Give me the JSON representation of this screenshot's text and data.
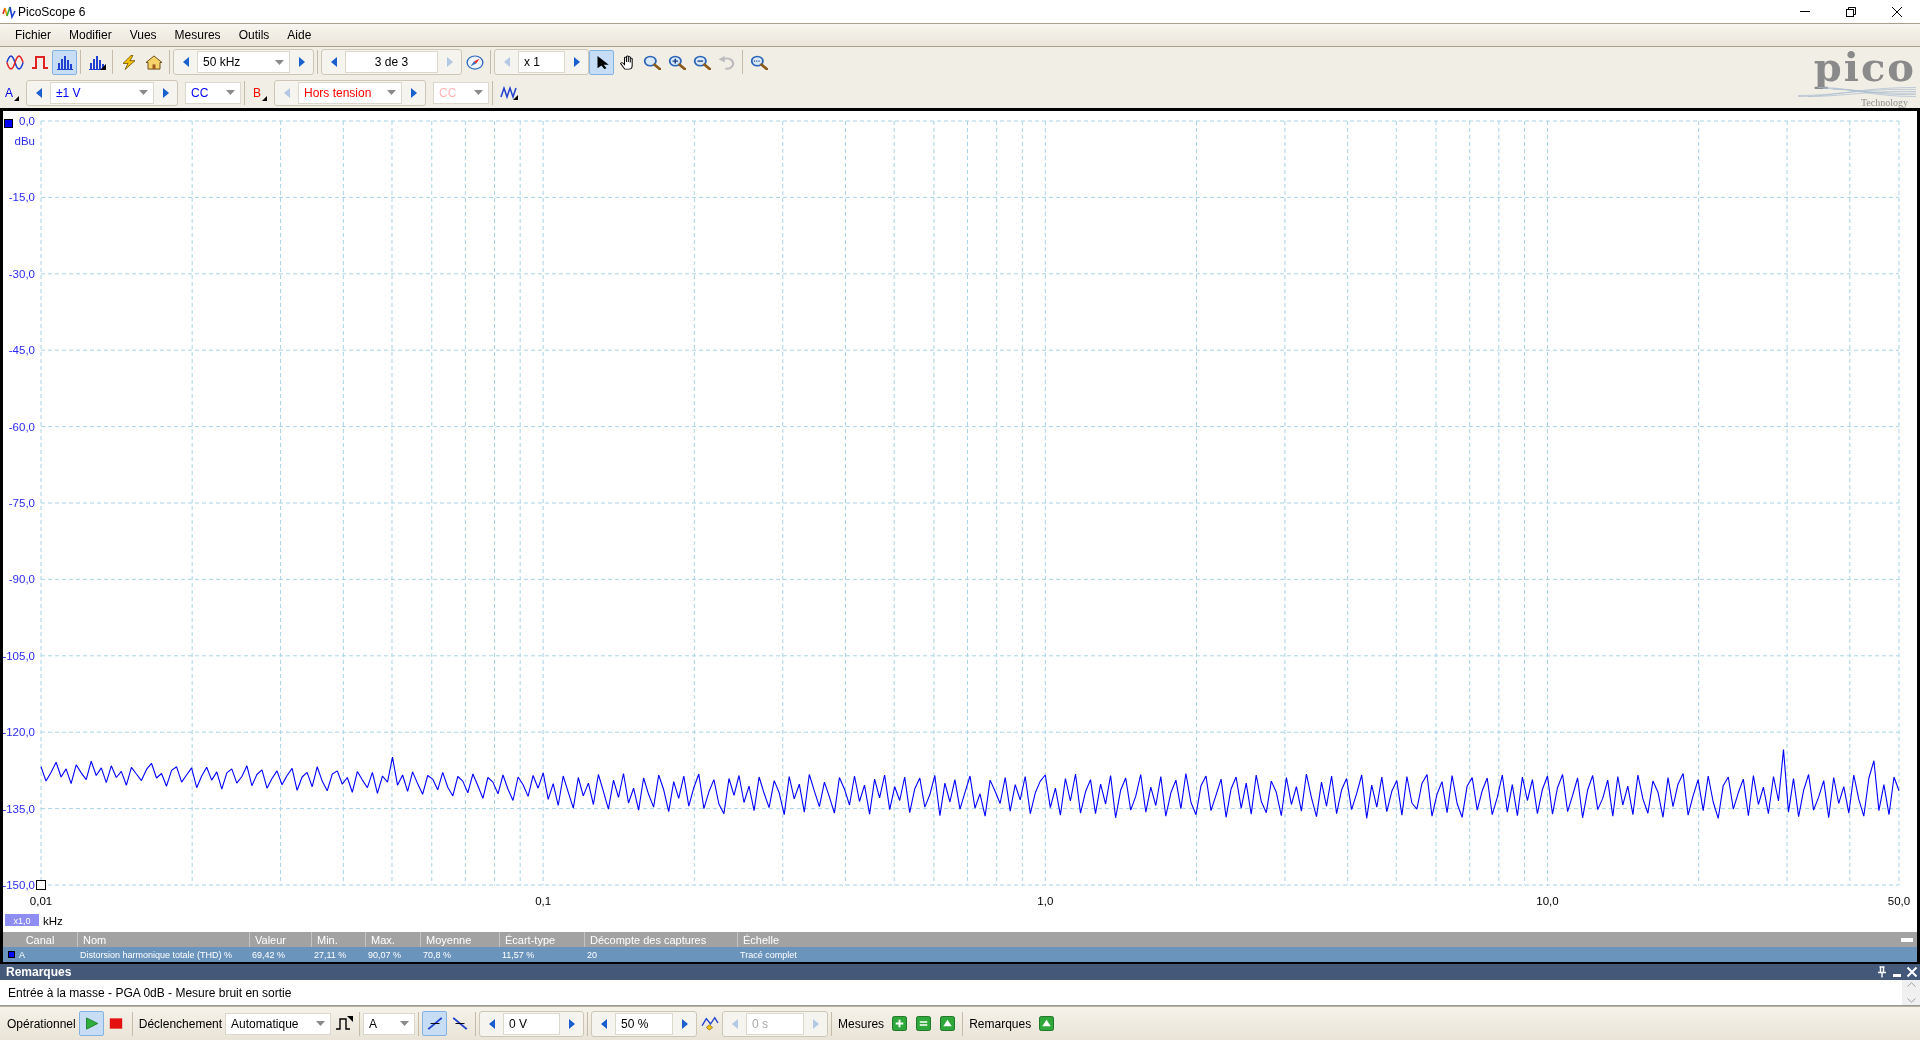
{
  "window": {
    "title": "PicoScope 6"
  },
  "menu": [
    "Fichier",
    "Modifier",
    "Vues",
    "Mesures",
    "Outils",
    "Aide"
  ],
  "toolbar": {
    "modes": [
      {
        "kind": "scope",
        "selected": false
      },
      {
        "kind": "persistence",
        "selected": false
      },
      {
        "kind": "spectrum",
        "selected": true
      }
    ],
    "frequency_range": {
      "value": "50 kHz",
      "prev_disabled": false,
      "next_disabled": false
    },
    "capture": {
      "value": "3 de 3",
      "prev_disabled": false,
      "next_disabled": true
    },
    "zoom": {
      "value": "x 1",
      "prev_disabled": true,
      "next_disabled": false
    },
    "tools": [
      {
        "kind": "pointer",
        "selected": true
      },
      {
        "kind": "hand",
        "selected": false
      },
      {
        "kind": "zoom",
        "selected": false
      },
      {
        "kind": "zoom_in",
        "selected": false
      },
      {
        "kind": "zoom_out",
        "selected": false
      }
    ],
    "undo": {
      "disabled": true
    }
  },
  "logo": {
    "wordmark": "pico",
    "tagline": "Technology"
  },
  "channels": [
    {
      "label": "A",
      "color": "#0000ff",
      "range": {
        "value": "±1 V",
        "prev_disabled": false,
        "next_disabled": false
      },
      "coupling": "CC",
      "coupling_disabled": false
    },
    {
      "label": "B",
      "color": "#ff0000",
      "range": {
        "value": "Hors tension",
        "prev_disabled": true,
        "next_disabled": false
      },
      "coupling": "CC",
      "coupling_disabled": true
    }
  ],
  "plot": {
    "zoom_badge": "x1,0",
    "chart_data": {
      "type": "line",
      "xlabel": "kHz",
      "ylabel": "dBu",
      "grid": true,
      "ylim": [
        -150,
        0
      ],
      "yticks": [
        {
          "value": 0,
          "label": "0,0"
        },
        {
          "value": -15,
          "label": "-15,0"
        },
        {
          "value": -30,
          "label": "-30,0"
        },
        {
          "value": -45,
          "label": "-45,0"
        },
        {
          "value": -60,
          "label": "-60,0"
        },
        {
          "value": -75,
          "label": "-75,0"
        },
        {
          "value": -90,
          "label": "-90,0"
        },
        {
          "value": -105,
          "label": "-105,0"
        },
        {
          "value": -120,
          "label": "-120,0"
        },
        {
          "value": -135,
          "label": "-135,0"
        },
        {
          "value": -150,
          "label": "-150,0"
        }
      ],
      "categories": [
        "0,01",
        null,
        null,
        null,
        null,
        null,
        null,
        null,
        null,
        null,
        null,
        null,
        null,
        null,
        null,
        null,
        null,
        null,
        null,
        null,
        null,
        null,
        null,
        null,
        null,
        null,
        null,
        null,
        null,
        null,
        null,
        null,
        null,
        null,
        null,
        null,
        null,
        null,
        null,
        null,
        null,
        null,
        null,
        null,
        null,
        null,
        null,
        null,
        null,
        null,
        null,
        null,
        null,
        null,
        null,
        null,
        null,
        null,
        null,
        null,
        null,
        null,
        null,
        null,
        null,
        null,
        null,
        null,
        null,
        null,
        null,
        null,
        null,
        null,
        null,
        null,
        null,
        null,
        null,
        null,
        null,
        null,
        null,
        null,
        null,
        null,
        null,
        null,
        null,
        null,
        null,
        null,
        null,
        null,
        null,
        null,
        null,
        null,
        null,
        null,
        "0,1",
        null,
        null,
        null,
        null,
        null,
        null,
        null,
        null,
        null,
        null,
        null,
        null,
        null,
        null,
        null,
        null,
        null,
        null,
        null,
        null,
        null,
        null,
        null,
        null,
        null,
        null,
        null,
        null,
        null,
        null,
        null,
        null,
        null,
        null,
        null,
        null,
        null,
        null,
        null,
        null,
        null,
        null,
        null,
        null,
        null,
        null,
        null,
        null,
        null,
        null,
        null,
        null,
        null,
        null,
        null,
        null,
        null,
        null,
        null,
        null,
        null,
        null,
        null,
        null,
        null,
        null,
        null,
        null,
        null,
        null,
        null,
        null,
        null,
        null,
        null,
        null,
        null,
        null,
        null,
        null,
        null,
        null,
        null,
        null,
        null,
        null,
        null,
        null,
        null,
        null,
        null,
        null,
        null,
        null,
        null,
        null,
        null,
        null,
        null,
        "1,0",
        null,
        null,
        null,
        null,
        null,
        null,
        null,
        null,
        null,
        null,
        null,
        null,
        null,
        null,
        null,
        null,
        null,
        null,
        null,
        null,
        null,
        null,
        null,
        null,
        null,
        null,
        null,
        null,
        null,
        null,
        null,
        null,
        null,
        null,
        null,
        null,
        null,
        null,
        null,
        null,
        null,
        null,
        null,
        null,
        null,
        null,
        null,
        null,
        null,
        null,
        null,
        null,
        null,
        null,
        null,
        null,
        null,
        null,
        null,
        null,
        null,
        null,
        null,
        null,
        null,
        null,
        null,
        null,
        null,
        null,
        null,
        null,
        null,
        null,
        null,
        null,
        null,
        null,
        null,
        null,
        null,
        null,
        null,
        null,
        null,
        null,
        null,
        null,
        null,
        null,
        null,
        null,
        null,
        null,
        null,
        null,
        null,
        null,
        null,
        "10,0",
        null,
        null,
        null,
        null,
        null,
        null,
        null,
        null,
        null,
        null,
        null,
        null,
        null,
        null,
        null,
        null,
        null,
        null,
        null,
        null,
        null,
        null,
        null,
        null,
        null,
        null,
        null,
        null,
        null,
        null,
        null,
        null,
        null,
        null,
        null,
        null,
        null,
        null,
        null,
        null,
        null,
        null,
        null,
        null,
        null,
        null,
        null,
        null,
        null,
        null,
        null,
        null,
        null,
        null,
        null,
        null,
        null,
        null,
        null,
        null,
        null,
        null,
        null,
        null,
        null,
        null,
        null,
        null,
        null,
        "50,0"
      ],
      "series": [
        {
          "color": "#0000ff",
          "values": [
            -126.8,
            -129.6,
            -127.9,
            -125.9,
            -128.8,
            -127.2,
            -130.1,
            -126.4,
            -128.0,
            -129.3,
            -125.7,
            -128.5,
            -127.0,
            -129.9,
            -126.6,
            -128.9,
            -127.7,
            -130.4,
            -126.9,
            -128.2,
            -129.5,
            -127.3,
            -126.1,
            -129.0,
            -128.1,
            -130.6,
            -127.5,
            -126.8,
            -129.8,
            -128.4,
            -127.0,
            -130.9,
            -128.6,
            -126.9,
            -129.4,
            -127.8,
            -131.2,
            -128.0,
            -127.2,
            -130.0,
            -128.7,
            -126.6,
            -130.5,
            -128.3,
            -127.4,
            -131.0,
            -129.1,
            -127.6,
            -130.3,
            -128.5,
            -127.1,
            -131.4,
            -128.8,
            -127.9,
            -130.7,
            -126.8,
            -129.6,
            -131.5,
            -128.2,
            -127.6,
            -130.2,
            -128.9,
            -131.8,
            -127.7,
            -129.4,
            -130.9,
            -127.9,
            -132.0,
            -128.6,
            -129.8,
            -124.9,
            -130.4,
            -128.4,
            -131.6,
            -127.8,
            -130.1,
            -132.2,
            -128.5,
            -129.2,
            -131.3,
            -127.9,
            -130.8,
            -132.5,
            -128.7,
            -129.6,
            -131.9,
            -128.2,
            -130.5,
            -133.0,
            -128.9,
            -129.8,
            -132.1,
            -128.4,
            -131.2,
            -133.4,
            -128.8,
            -130.3,
            -132.6,
            -128.5,
            -131.0,
            -128.0,
            -133.2,
            -130.1,
            -134.4,
            -128.6,
            -131.8,
            -134.9,
            -128.9,
            -132.5,
            -130.0,
            -134.2,
            -128.3,
            -131.6,
            -135.1,
            -129.4,
            -132.8,
            -128.1,
            -133.9,
            -131.0,
            -135.3,
            -129.0,
            -132.2,
            -134.7,
            -128.4,
            -131.3,
            -135.6,
            -129.7,
            -133.0,
            -128.6,
            -134.5,
            -130.9,
            -128.2,
            -135.0,
            -131.7,
            -129.3,
            -134.1,
            -136.0,
            -129.1,
            -132.4,
            -128.5,
            -133.8,
            -130.6,
            -135.4,
            -128.8,
            -132.0,
            -134.8,
            -129.5,
            -131.9,
            -136.2,
            -128.7,
            -133.1,
            -130.2,
            -135.7,
            -128.3,
            -131.5,
            -134.6,
            -129.8,
            -132.7,
            -135.9,
            -128.9,
            -131.2,
            -134.3,
            -128.6,
            -133.6,
            -130.4,
            -136.1,
            -129.2,
            -132.9,
            -128.4,
            -135.2,
            -130.7,
            -133.4,
            -128.8,
            -135.8,
            -131.1,
            -129.0,
            -134.7,
            -132.3,
            -128.5,
            -136.4,
            -130.0,
            -133.7,
            -129.3,
            -135.1,
            -131.8,
            -128.6,
            -134.9,
            -132.1,
            -136.5,
            -129.4,
            -131.6,
            -134.0,
            -128.9,
            -135.5,
            -130.3,
            -133.3,
            -128.7,
            -136.0,
            -131.9,
            -129.6,
            -128.4,
            -134.8,
            -131.0,
            -136.3,
            -129.1,
            -133.5,
            -128.2,
            -135.9,
            -131.7,
            -129.3,
            -136.0,
            -130.2,
            -134.1,
            -128.5,
            -136.8,
            -131.4,
            -129.0,
            -135.3,
            -132.6,
            -128.3,
            -135.7,
            -130.8,
            -134.4,
            -128.7,
            -136.5,
            -131.9,
            -129.4,
            -135.0,
            -128.1,
            -133.8,
            -136.2,
            -130.5,
            -128.6,
            -135.4,
            -132.3,
            -129.2,
            -136.7,
            -131.1,
            -128.8,
            -134.9,
            -130.0,
            -136.1,
            -128.4,
            -133.6,
            -135.8,
            -129.6,
            -131.8,
            -136.4,
            -128.9,
            -134.2,
            -130.7,
            -135.5,
            -128.2,
            -132.9,
            -136.6,
            -129.8,
            -134.5,
            -128.6,
            -136.0,
            -131.3,
            -129.1,
            -135.2,
            -132.0,
            -128.4,
            -136.9,
            -130.4,
            -134.7,
            -128.8,
            -135.6,
            -131.6,
            -129.5,
            -136.3,
            -128.7,
            -133.9,
            -135.1,
            -130.1,
            -128.3,
            -136.5,
            -132.2,
            -129.7,
            -135.8,
            -128.5,
            -134.0,
            -136.7,
            -130.6,
            -128.9,
            -135.3,
            -131.5,
            -129.0,
            -136.2,
            -132.8,
            -128.4,
            -135.7,
            -130.3,
            -136.4,
            -128.8,
            -133.4,
            -129.3,
            -136.0,
            -131.2,
            -128.6,
            -136.1,
            -130.9,
            -128.3,
            -135.6,
            -132.4,
            -129.0,
            -136.8,
            -131.3,
            -128.5,
            -135.2,
            -133.0,
            -129.4,
            -136.5,
            -128.7,
            -134.3,
            -130.6,
            -136.2,
            -128.4,
            -133.1,
            -135.9,
            -129.6,
            -131.8,
            -136.7,
            -128.9,
            -134.6,
            -130.2,
            -128.1,
            -136.3,
            -132.5,
            -129.3,
            -135.4,
            -128.6,
            -133.7,
            -136.9,
            -130.5,
            -128.8,
            -135.1,
            -131.9,
            -129.2,
            -136.4,
            -128.5,
            -134.2,
            -130.8,
            -136.0,
            -128.7,
            -133.5,
            -123.4,
            -135.7,
            -129.1,
            -136.6,
            -131.4,
            -128.3,
            -135.3,
            -132.7,
            -129.5,
            -136.8,
            -128.9,
            -134.0,
            -130.7,
            -135.9,
            -128.4,
            -133.2,
            -136.5,
            -129.0,
            -125.6,
            -135.4,
            -130.3,
            -136.2,
            -128.8,
            -131.5
          ]
        }
      ]
    }
  },
  "measurements": {
    "columns": [
      "Canal",
      "Nom",
      "Valeur",
      "Min.",
      "Max.",
      "Moyenne",
      "Écart-type",
      "Décompte des captures",
      "Échelle"
    ],
    "rows": [
      {
        "selected": true,
        "cells": [
          "A",
          "Distorsion harmonique totale (THD) %",
          "69,42 %",
          "27,11 %",
          "90,07 %",
          "70,8 %",
          "11,57 %",
          "20",
          "Tracé complet"
        ]
      }
    ]
  },
  "notes": {
    "title": "Remarques",
    "text": "Entrée à la masse - PGA 0dB - Mesure bruit en sortie"
  },
  "status_bar": {
    "run": {
      "label": "Opérationnel",
      "running": true
    },
    "trigger": {
      "label": "Déclenchement",
      "mode": "Automatique",
      "source": "A",
      "edges": [
        {
          "kind": "rising",
          "selected": true
        },
        {
          "kind": "falling",
          "selected": false
        }
      ]
    },
    "threshold": {
      "value": "0 V",
      "prev_disabled": false,
      "next_disabled": false
    },
    "pretrigger": {
      "value": "50 %",
      "prev_disabled": false,
      "next_disabled": false
    },
    "delay": {
      "value": "0 s",
      "prev_disabled": true,
      "next_disabled": true,
      "disabled": true
    },
    "measurements_label": "Mesures",
    "notes_label": "Remarques"
  }
}
